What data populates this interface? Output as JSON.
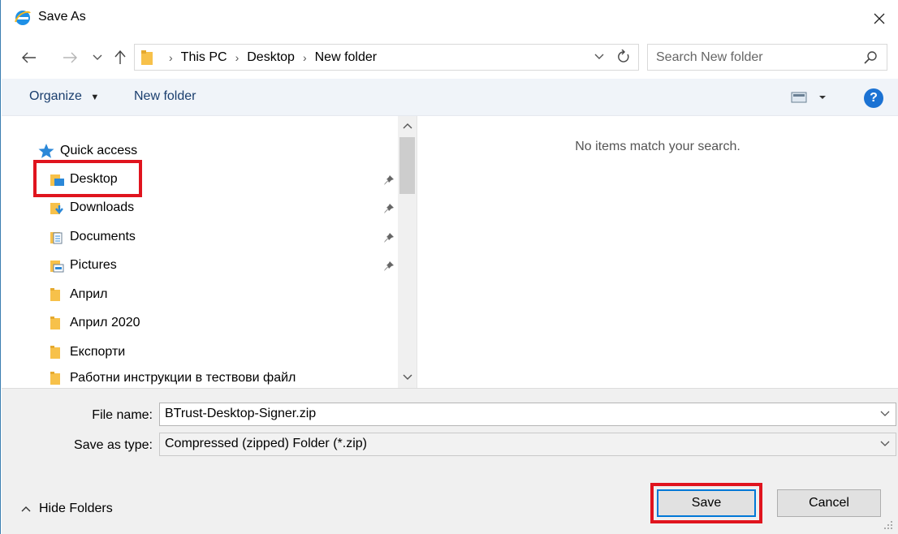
{
  "window": {
    "title": "Save As"
  },
  "address": {
    "breadcrumbs": [
      "This PC",
      "Desktop",
      "New folder"
    ]
  },
  "search": {
    "placeholder": "Search New folder"
  },
  "toolbar": {
    "organize_label": "Organize",
    "new_folder_label": "New folder"
  },
  "nav": {
    "quick_access_label": "Quick access",
    "items": [
      {
        "label": "Desktop",
        "icon": "desktop-folder-icon",
        "pinned": true
      },
      {
        "label": "Downloads",
        "icon": "downloads-folder-icon",
        "pinned": true
      },
      {
        "label": "Documents",
        "icon": "documents-folder-icon",
        "pinned": true
      },
      {
        "label": "Pictures",
        "icon": "pictures-folder-icon",
        "pinned": true
      },
      {
        "label": "Април",
        "icon": "folder-icon",
        "pinned": false
      },
      {
        "label": "Април 2020",
        "icon": "folder-icon",
        "pinned": false
      },
      {
        "label": "Експорти",
        "icon": "folder-icon",
        "pinned": false
      },
      {
        "label": "Работни инструкции в тествови файл",
        "icon": "folder-icon",
        "pinned": false
      }
    ]
  },
  "content": {
    "empty_message": "No items match your search."
  },
  "form": {
    "file_name_label": "File name:",
    "file_name_value": "BTrust-Desktop-Signer.zip",
    "save_type_label": "Save as type:",
    "save_type_value": "Compressed (zipped) Folder (*.zip)"
  },
  "footer": {
    "hide_folders_label": "Hide Folders",
    "save_label": "Save",
    "cancel_label": "Cancel"
  },
  "colors": {
    "highlight_outline": "#e0141e",
    "accent": "#0078d7",
    "toolbar_bg": "#f0f4f9",
    "folder": "#f7c14a"
  }
}
